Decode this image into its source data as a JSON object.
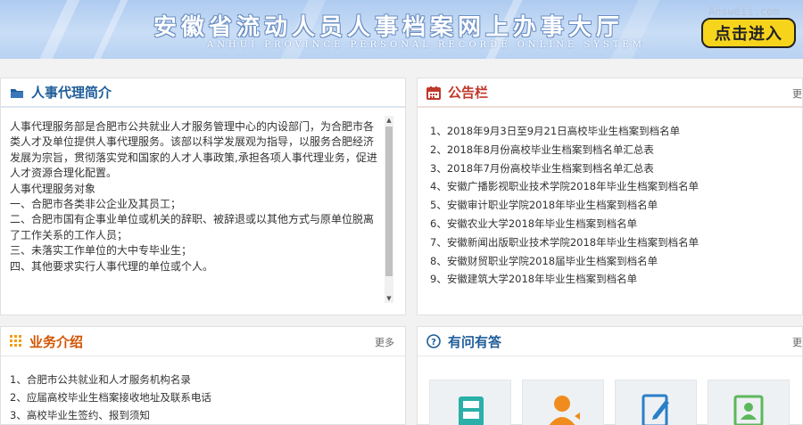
{
  "banner": {
    "title": "安徽省流动人员人事档案网上办事大厅",
    "subtitle": "ANHUI PROVINCE PERSONAL RECORDE ONLINE SYSTEM",
    "enter_button": "点击进入",
    "watermark": "Answeii.com"
  },
  "intro": {
    "title": "人事代理简介",
    "icon": "folder-icon",
    "lines": [
      "人事代理服务部是合肥市公共就业人才服务管理中心的内设部门，为合肥市各",
      "类人才及单位提供人事代理服务。该部以科学发展观为指导，以服务合肥经济",
      "发展为宗旨，贯彻落实党和国家的人才人事政策,承担各项人事代理业务，促进",
      "人才资源合理化配置。",
      "人事代理服务对象",
      "一、合肥市各类非公企业及其员工；",
      "二、合肥市国有企事业单位或机关的辞职、被辞退或以其他方式与原单位脱离",
      "了工作关系的工作人员；",
      "三、未落实工作单位的大中专毕业生；",
      "四、其他要求实行人事代理的单位或个人。"
    ]
  },
  "notice": {
    "title": "公告栏",
    "icon": "calendar-icon",
    "more": "更",
    "items": [
      "1、2018年9月3日至9月21日高校毕业生档案到档名单",
      "2、2018年8月份高校毕业生档案到档名单汇总表",
      "3、2018年7月份高校毕业生档案到档名单汇总表",
      "4、安徽广播影视职业技术学院2018年毕业生档案到档名单",
      "5、安徽审计职业学院2018年毕业生档案到档名单",
      "6、安徽农业大学2018年毕业生档案到档名单",
      "7、安徽新闻出版职业技术学院2018年毕业生档案到档名单",
      "8、安徽财贸职业学院2018届毕业生档案到档名单",
      "9、安徽建筑大学2018年毕业生档案到档名单"
    ]
  },
  "business": {
    "title": "业务介绍",
    "icon": "grid-icon",
    "more": "更多",
    "items": [
      "1、合肥市公共就业和人才服务机构名录",
      "2、应届高校毕业生档案接收地址及联系电话",
      "3、高校毕业生签约、报到须知"
    ]
  },
  "faq": {
    "title": "有问有答",
    "icon": "question-icon",
    "more": "更",
    "cards": [
      "cabinet-icon",
      "person-icon",
      "edit-icon",
      "id-card-icon"
    ]
  },
  "colors": {
    "blue_title": "#1f5d99",
    "red_title": "#c0392b",
    "orange_icon": "#f39c12",
    "enter_yellow": "#f7d41c"
  }
}
